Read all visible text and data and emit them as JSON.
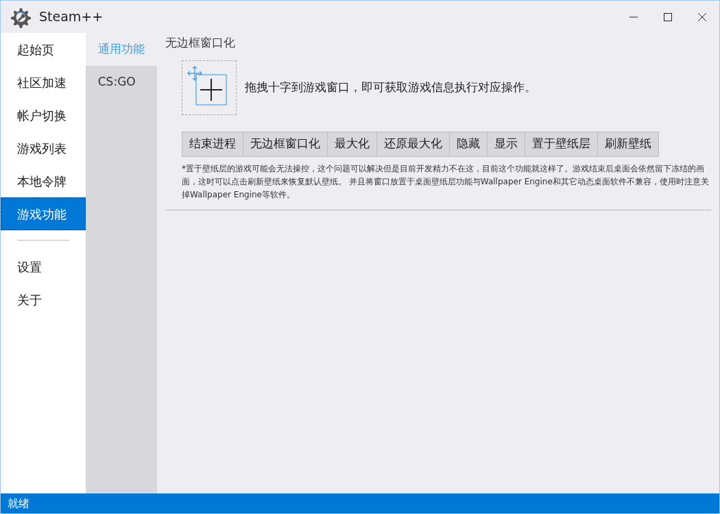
{
  "window": {
    "title": "Steam++"
  },
  "sidebar": {
    "items": [
      {
        "label": "起始页",
        "selected": false
      },
      {
        "label": "社区加速",
        "selected": false
      },
      {
        "label": "帐户切换",
        "selected": false
      },
      {
        "label": "游戏列表",
        "selected": false
      },
      {
        "label": "本地令牌",
        "selected": false
      },
      {
        "label": "游戏功能",
        "selected": true
      }
    ],
    "bottom_items": [
      {
        "label": "设置",
        "selected": false
      },
      {
        "label": "关于",
        "selected": false
      }
    ]
  },
  "subnav": [
    {
      "label": "通用功能",
      "selected": true
    },
    {
      "label": "CS:GO",
      "selected": false
    }
  ],
  "section_title": "无边框窗口化",
  "drag_hint": "拖拽十字到游戏窗口，即可获取游戏信息执行对应操作。",
  "buttons": [
    "结束进程",
    "无边框窗口化",
    "最大化",
    "还原最大化",
    "隐藏",
    "显示",
    "置于壁纸层",
    "刷新壁纸"
  ],
  "note": "*置于壁纸层的游戏可能会无法操控，这个问题可以解决但是目前开发精力不在这，目前这个功能就这样了。游戏结束后桌面会依然留下冻结的画面，这时可以点击刷新壁纸来恢复默认壁纸。 并且将窗口放置于桌面壁纸层功能与Wallpaper Engine和其它动态桌面软件不兼容，使用时注意关掉Wallpaper Engine等软件。",
  "status_bar": "就绪"
}
